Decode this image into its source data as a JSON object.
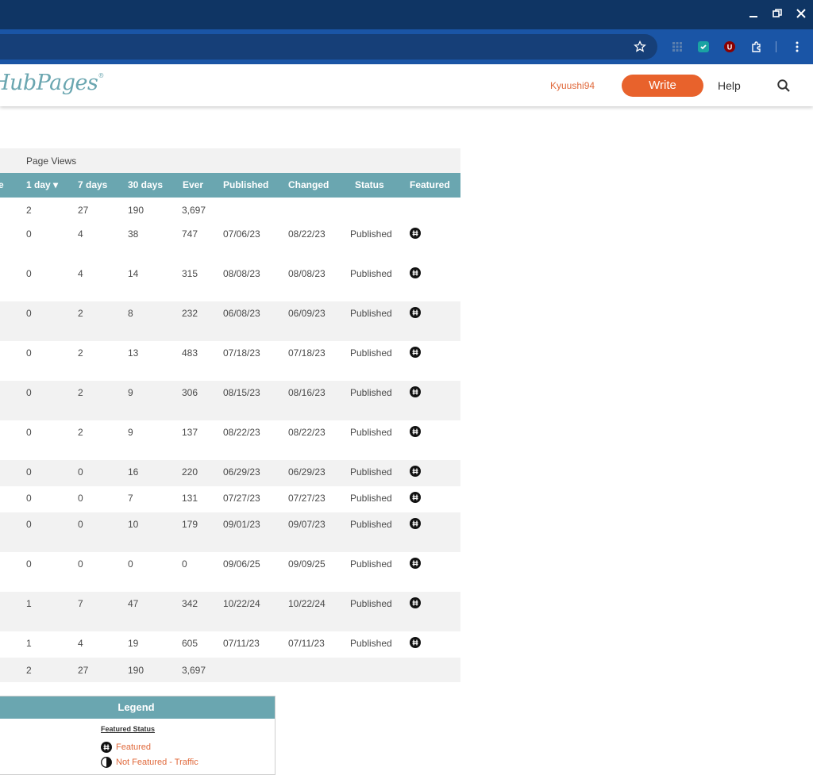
{
  "browser": {
    "window_controls": [
      "minimize",
      "restore",
      "close"
    ],
    "toolbar_icons": [
      "star-icon",
      "grid-icon",
      "extension-green-icon",
      "ublock-icon",
      "puzzle-icon",
      "kebab-menu-icon"
    ]
  },
  "header": {
    "logo": "HubPages",
    "username": "Kyuushi94",
    "write_label": "Write",
    "help_label": "Help"
  },
  "table": {
    "page_views_label": "Page Views",
    "headers": {
      "score_partial": "e",
      "day1": "1 day ▾",
      "day7": "7 days",
      "day30": "30 days",
      "ever": "Ever",
      "published": "Published",
      "changed": "Changed",
      "status": "Status",
      "featured": "Featured"
    },
    "totals_top": {
      "d1": "2",
      "d7": "27",
      "d30": "190",
      "ever": "3,697"
    },
    "rows": [
      {
        "d1": "0",
        "d7": "4",
        "d30": "38",
        "ever": "747",
        "published": "07/06/23",
        "changed": "08/22/23",
        "status": "Published"
      },
      {
        "d1": "0",
        "d7": "4",
        "d30": "14",
        "ever": "315",
        "published": "08/08/23",
        "changed": "08/08/23",
        "status": "Published"
      },
      {
        "d1": "0",
        "d7": "2",
        "d30": "8",
        "ever": "232",
        "published": "06/08/23",
        "changed": "06/09/23",
        "status": "Published"
      },
      {
        "d1": "0",
        "d7": "2",
        "d30": "13",
        "ever": "483",
        "published": "07/18/23",
        "changed": "07/18/23",
        "status": "Published"
      },
      {
        "d1": "0",
        "d7": "2",
        "d30": "9",
        "ever": "306",
        "published": "08/15/23",
        "changed": "08/16/23",
        "status": "Published"
      },
      {
        "d1": "0",
        "d7": "2",
        "d30": "9",
        "ever": "137",
        "published": "08/22/23",
        "changed": "08/22/23",
        "status": "Published"
      },
      {
        "d1": "0",
        "d7": "0",
        "d30": "16",
        "ever": "220",
        "published": "06/29/23",
        "changed": "06/29/23",
        "status": "Published"
      },
      {
        "d1": "0",
        "d7": "0",
        "d30": "7",
        "ever": "131",
        "published": "07/27/23",
        "changed": "07/27/23",
        "status": "Published"
      },
      {
        "d1": "0",
        "d7": "0",
        "d30": "10",
        "ever": "179",
        "published": "09/01/23",
        "changed": "09/07/23",
        "status": "Published"
      },
      {
        "d1": "0",
        "d7": "0",
        "d30": "0",
        "ever": "0",
        "published": "09/06/25",
        "changed": "09/09/25",
        "status": "Published"
      },
      {
        "d1": "1",
        "d7": "7",
        "d30": "47",
        "ever": "342",
        "published": "10/22/24",
        "changed": "10/22/24",
        "status": "Published"
      },
      {
        "d1": "1",
        "d7": "4",
        "d30": "19",
        "ever": "605",
        "published": "07/11/23",
        "changed": "07/11/23",
        "status": "Published"
      }
    ],
    "totals_bottom": {
      "d1": "2",
      "d7": "27",
      "d30": "190",
      "ever": "3,697"
    }
  },
  "legend": {
    "title": "Legend",
    "subtitle": "Featured Status",
    "items": [
      "Featured",
      "Not Featured - Traffic"
    ]
  },
  "colors": {
    "accent": "#6aa6b0",
    "brand_orange": "#e8622c",
    "chrome_dark": "#0f3564",
    "chrome_toolbar": "#1a55a6"
  }
}
